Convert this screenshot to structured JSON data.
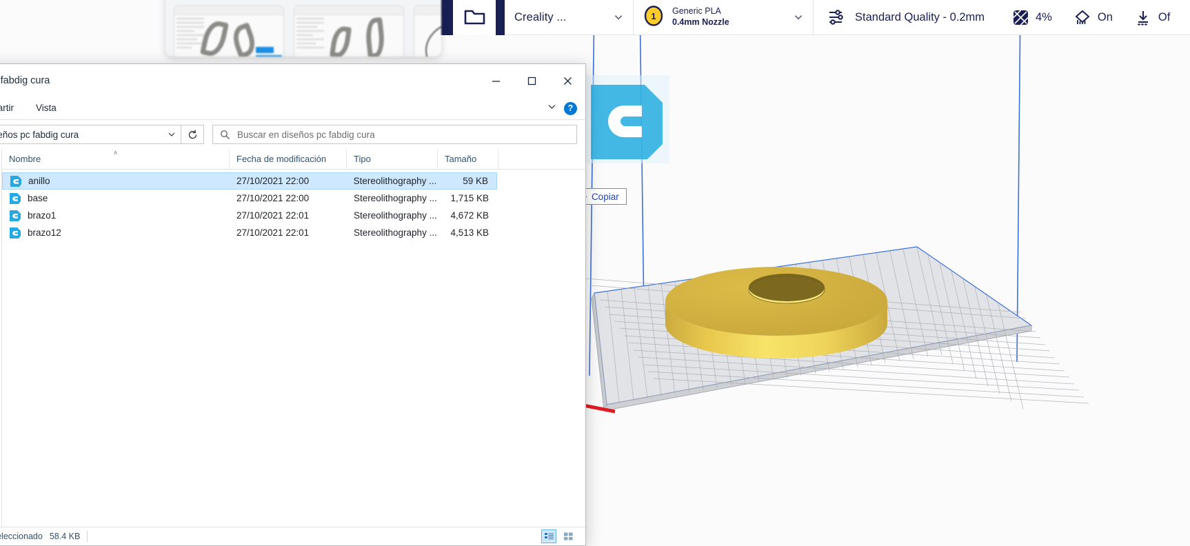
{
  "cura": {
    "toolbar": {
      "open_file_icon": "folder-open-icon",
      "printer": {
        "label": "Creality ...",
        "chevron": "chevron-down-icon"
      },
      "material": {
        "extruder_number": "1",
        "name": "Generic PLA",
        "nozzle": "0.4mm Nozzle",
        "chevron": "chevron-down-icon"
      },
      "profile": {
        "icon": "sliders-icon",
        "label": "Standard Quality - 0.2mm"
      },
      "infill": {
        "icon": "infill-grid-icon",
        "label": "4%"
      },
      "support": {
        "icon": "support-icon",
        "label": "On"
      },
      "adhesion": {
        "icon": "adhesion-icon",
        "label": "Of"
      }
    },
    "viewport": {
      "model_name": "ring-model",
      "model_color": "#e8c64a",
      "buildplate_color": "#d8d9dc",
      "outline_color": "#3a6fd8"
    }
  },
  "drag": {
    "ghost_icon": "cura-file-icon",
    "tooltip_plus": "+",
    "tooltip_label": "Copiar"
  },
  "explorer": {
    "title": "s pc fabdig cura",
    "window_buttons": {
      "minimize": "minimize-icon",
      "maximize": "maximize-icon",
      "close": "close-icon"
    },
    "ribbon": {
      "tabs": [
        "mpartir",
        "Vista"
      ],
      "collapse": "chevron-down-icon",
      "help": "?"
    },
    "addressbar": {
      "path_value": "diseños pc fabdig cura",
      "path_chevron": "chevron-down-icon",
      "refresh_icon": "refresh-icon",
      "search_icon": "search-icon",
      "search_value": "",
      "search_placeholder": "Buscar en diseños pc fabdig cura"
    },
    "columns": [
      {
        "key": "name",
        "label": "Nombre",
        "sorted": true,
        "sort_caret": "˄"
      },
      {
        "key": "date",
        "label": "Fecha de modificación",
        "sorted": false
      },
      {
        "key": "type",
        "label": "Tipo",
        "sorted": false
      },
      {
        "key": "size",
        "label": "Tamaño",
        "sorted": false
      }
    ],
    "files": [
      {
        "icon": "cura-file-icon",
        "name": "anillo",
        "date": "27/10/2021 22:00",
        "type": "Stereolithography ...",
        "size": "59 KB",
        "selected": true
      },
      {
        "icon": "cura-file-icon",
        "name": "base",
        "date": "27/10/2021 22:00",
        "type": "Stereolithography ...",
        "size": "1,715 KB",
        "selected": false
      },
      {
        "icon": "cura-file-icon",
        "name": "brazo1",
        "date": "27/10/2021 22:01",
        "type": "Stereolithography ...",
        "size": "4,672 KB",
        "selected": false
      },
      {
        "icon": "cura-file-icon",
        "name": "brazo12",
        "date": "27/10/2021 22:01",
        "type": "Stereolithography ...",
        "size": "4,513 KB",
        "selected": false
      }
    ],
    "statusbar": {
      "selection_text": "nto seleccionado",
      "selection_size": "58.4 KB",
      "view_details_icon": "details-view-icon",
      "view_large_icon": "large-icons-view-icon"
    }
  },
  "colors": {
    "cura_navy": "#1a1f53",
    "cura_cyan": "#34b3e4",
    "selection_blue": "#cde8ff",
    "accent_blue": "#0078d7",
    "model_yellow": "#e8c64a"
  }
}
